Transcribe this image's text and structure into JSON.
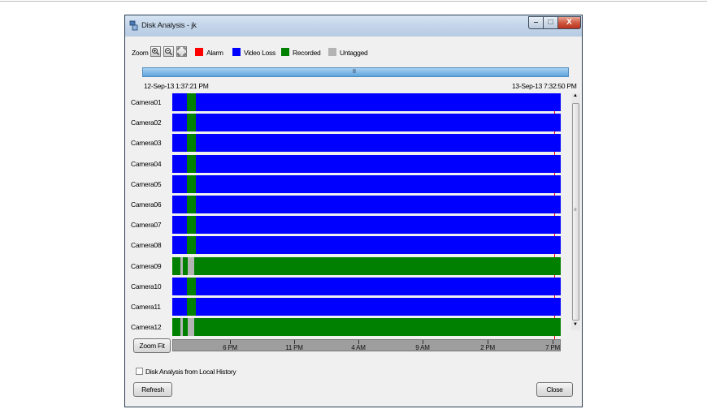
{
  "window": {
    "title": "Disk Analysis - jk"
  },
  "toolbar": {
    "zoom_label": "Zoom",
    "legend": [
      {
        "label": "Alarm",
        "color": "#ff0000"
      },
      {
        "label": "Video Loss",
        "color": "#0000ff"
      },
      {
        "label": "Recorded",
        "color": "#008000"
      },
      {
        "label": "Untagged",
        "color": "#b4b4b4"
      }
    ]
  },
  "range": {
    "start": "12-Sep-13 1:37:21 PM",
    "end": "13-Sep-13 7:32:50 PM",
    "scroll_grip": "II"
  },
  "cameras": [
    {
      "name": "Camera01",
      "pattern": "A"
    },
    {
      "name": "Camera02",
      "pattern": "A"
    },
    {
      "name": "Camera03",
      "pattern": "A"
    },
    {
      "name": "Camera04",
      "pattern": "A"
    },
    {
      "name": "Camera05",
      "pattern": "A"
    },
    {
      "name": "Camera06",
      "pattern": "A"
    },
    {
      "name": "Camera07",
      "pattern": "A"
    },
    {
      "name": "Camera08",
      "pattern": "A"
    },
    {
      "name": "Camera09",
      "pattern": "B"
    },
    {
      "name": "Camera10",
      "pattern": "A"
    },
    {
      "name": "Camera11",
      "pattern": "A"
    },
    {
      "name": "Camera12",
      "pattern": "B"
    }
  ],
  "axis_ticks": [
    "6 PM",
    "11 PM",
    "4 AM",
    "9 AM",
    "2 PM",
    "7 PM"
  ],
  "buttons": {
    "zoom_fit": "Zoom Fit",
    "refresh": "Refresh",
    "close": "Close"
  },
  "options": {
    "local_history_label": "Disk Analysis from Local History",
    "local_history_checked": false
  }
}
